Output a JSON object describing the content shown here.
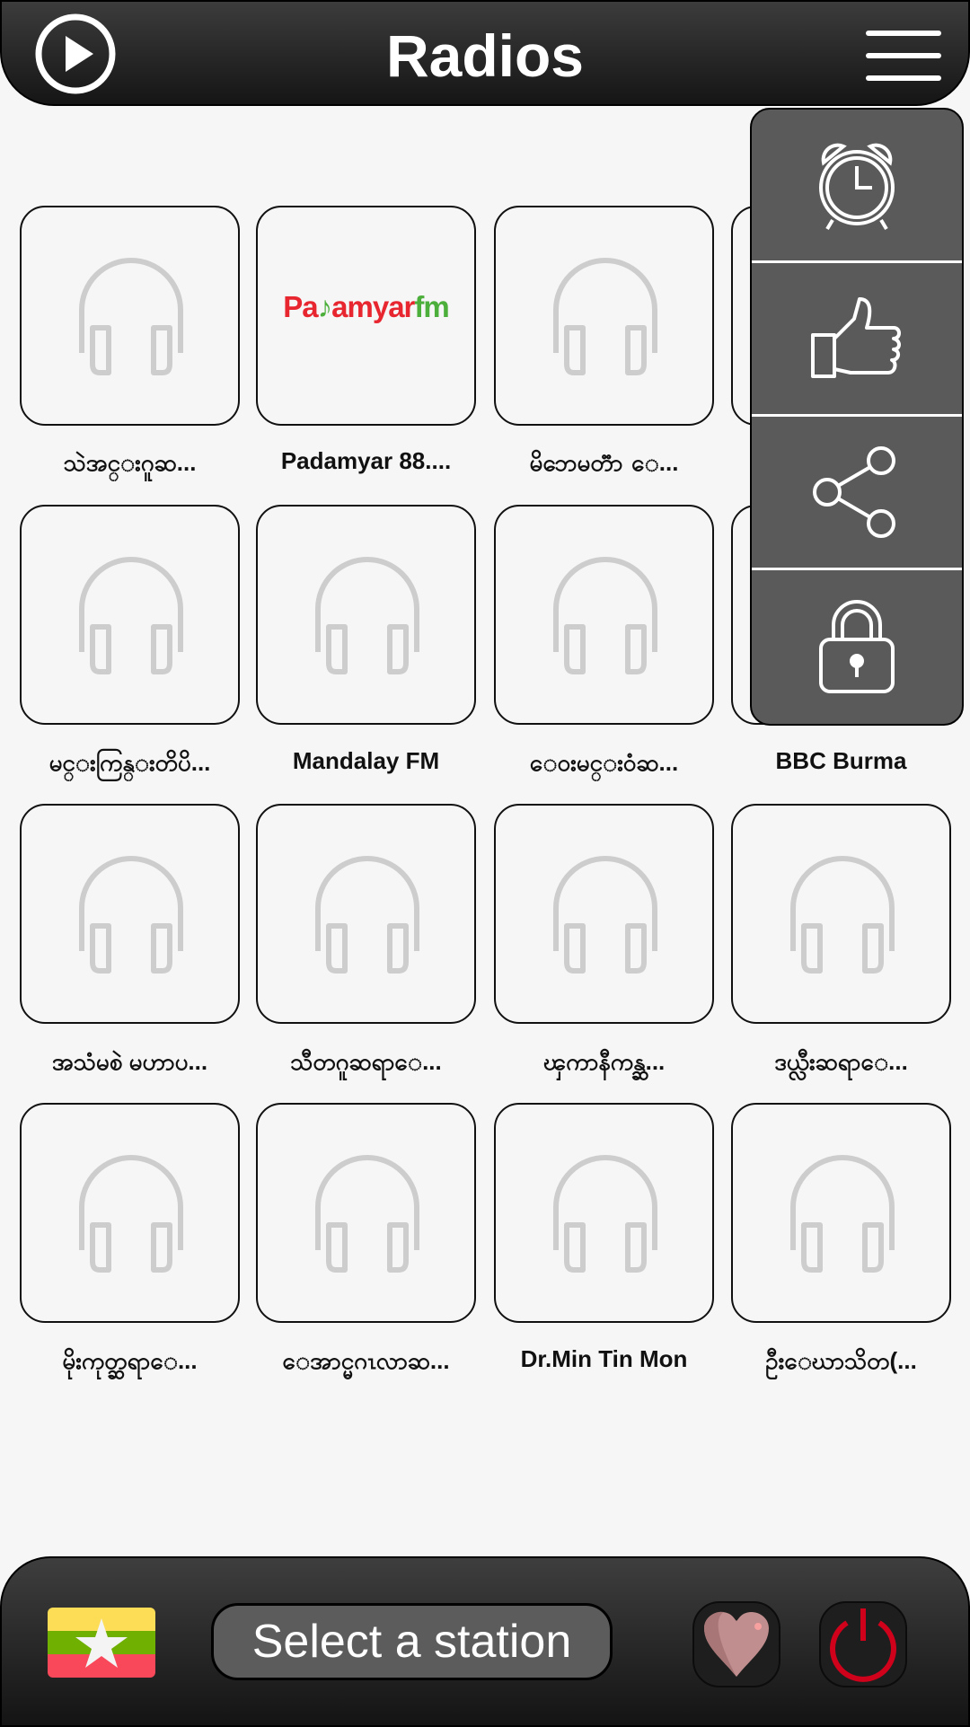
{
  "header": {
    "title": "Radios",
    "play_icon": "play-circle-icon",
    "menu_icon": "hamburger-menu-icon"
  },
  "popup_menu": {
    "items": [
      {
        "name": "alarm",
        "icon": "alarm-clock-icon"
      },
      {
        "name": "rate",
        "icon": "thumbs-up-icon"
      },
      {
        "name": "share",
        "icon": "share-icon"
      },
      {
        "name": "privacy",
        "icon": "lock-icon"
      }
    ]
  },
  "stations": [
    {
      "label": "သဲအင္းဂူဆ...",
      "logo": false
    },
    {
      "label": "Padamyar 88....",
      "logo": true,
      "logo_text_a": "Pa",
      "logo_text_b": "amyar",
      "logo_text_c": "fm"
    },
    {
      "label": "မိဘေမတၱာ ေ...",
      "logo": false
    },
    {
      "label": "",
      "logo": false
    },
    {
      "label": "မင္းကြန္းတိပိ...",
      "logo": false
    },
    {
      "label": "Mandalay FM",
      "logo": false
    },
    {
      "label": "ေ၀းမင္းဝံဆ...",
      "logo": false
    },
    {
      "label": "BBC Burma",
      "logo": false
    },
    {
      "label": "အသံမစဲ မဟာပ...",
      "logo": false
    },
    {
      "label": "သီတဂူဆရာေ...",
      "logo": false
    },
    {
      "label": "ၾကာနီကန္ဆ...",
      "logo": false
    },
    {
      "label": "ဒယ္လီးဆရာေ...",
      "logo": false
    },
    {
      "label": "မိုးကုတ္ဆရာေ...",
      "logo": false
    },
    {
      "label": "ေအာင္မဂၤလာဆ...",
      "logo": false
    },
    {
      "label": "Dr.Min Tin Mon",
      "logo": false
    },
    {
      "label": "ဦးေဃာသိတ(...",
      "logo": false
    }
  ],
  "footer": {
    "flag_icon": "myanmar-flag-icon",
    "select_label": "Select a station",
    "favorite_icon": "heart-icon",
    "power_icon": "power-icon"
  },
  "colors": {
    "logo_red": "#e8262f",
    "logo_green": "#4caf3c",
    "power_red": "#d0021b",
    "heart": "#c08e8e"
  }
}
